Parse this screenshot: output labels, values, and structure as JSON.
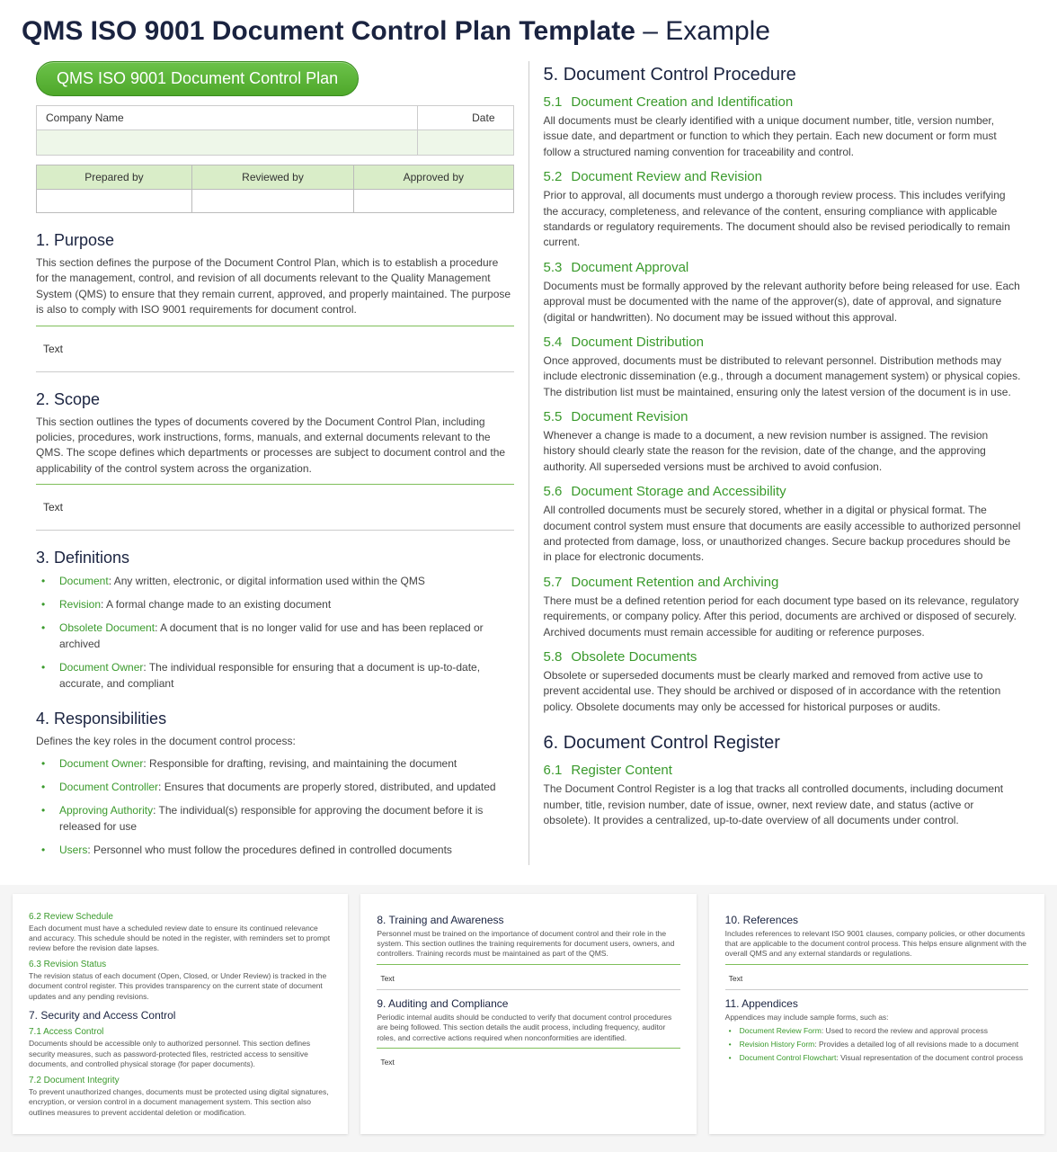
{
  "title_main": "QMS ISO 9001 Document Control Plan Template",
  "title_suffix": " – Example",
  "pill": "QMS ISO 9001 Document Control Plan",
  "meta": {
    "company": "Company Name",
    "date": "Date",
    "blank": ""
  },
  "rev": {
    "prepared": "Prepared by",
    "reviewed": "Reviewed by",
    "approved": "Approved by"
  },
  "sec1": {
    "h": "1. Purpose",
    "p": "This section defines the purpose of the Document Control Plan, which is to establish a procedure for the management, control, and revision of all documents relevant to the Quality Management System (QMS) to ensure that they remain current, approved, and properly maintained. The purpose is also to comply with ISO 9001 requirements for document control.",
    "ph": "Text"
  },
  "sec2": {
    "h": "2. Scope",
    "p": "This section outlines the types of documents covered by the Document Control Plan, including policies, procedures, work instructions, forms, manuals, and external documents relevant to the QMS. The scope defines which departments or processes are subject to document control and the applicability of the control system across the organization.",
    "ph": "Text"
  },
  "sec3": {
    "h": "3. Definitions",
    "items": [
      {
        "t": "Document",
        "d": ": Any written, electronic, or digital information used within the QMS"
      },
      {
        "t": "Revision",
        "d": ": A formal change made to an existing document"
      },
      {
        "t": "Obsolete Document",
        "d": ": A document that is no longer valid for use and has been replaced or archived"
      },
      {
        "t": "Document Owner",
        "d": ": The individual responsible for ensuring that a document is up-to-date, accurate, and compliant"
      }
    ]
  },
  "sec4": {
    "h": "4. Responsibilities",
    "p": "Defines the key roles in the document control process:",
    "items": [
      {
        "t": "Document Owner",
        "d": ": Responsible for drafting, revising, and maintaining the document"
      },
      {
        "t": "Document Controller",
        "d": ": Ensures that documents are properly stored, distributed, and updated"
      },
      {
        "t": "Approving Authority",
        "d": ": The individual(s) responsible for approving the document before it is released for use"
      },
      {
        "t": "Users",
        "d": ": Personnel who must follow the procedures defined in controlled documents"
      }
    ]
  },
  "sec5": {
    "h": "5. Document Control Procedure",
    "subs": [
      {
        "n": "5.1",
        "t": "Document Creation and Identification",
        "p": "All documents must be clearly identified with a unique document number, title, version number, issue date, and department or function to which they pertain. Each new document or form must follow a structured naming convention for traceability and control."
      },
      {
        "n": "5.2",
        "t": "Document Review and Revision",
        "p": "Prior to approval, all documents must undergo a thorough review process. This includes verifying the accuracy, completeness, and relevance of the content, ensuring compliance with applicable standards or regulatory requirements. The document should also be revised periodically to remain current."
      },
      {
        "n": "5.3",
        "t": "Document Approval",
        "p": "Documents must be formally approved by the relevant authority before being released for use. Each approval must be documented with the name of the approver(s), date of approval, and signature (digital or handwritten). No document may be issued without this approval."
      },
      {
        "n": "5.4",
        "t": "Document Distribution",
        "p": "Once approved, documents must be distributed to relevant personnel. Distribution methods may include electronic dissemination (e.g., through a document management system) or physical copies. The distribution list must be maintained, ensuring only the latest version of the document is in use."
      },
      {
        "n": "5.5",
        "t": "Document Revision",
        "p": "Whenever a change is made to a document, a new revision number is assigned. The revision history should clearly state the reason for the revision, date of the change, and the approving authority. All superseded versions must be archived to avoid confusion."
      },
      {
        "n": "5.6",
        "t": "Document Storage and Accessibility",
        "p": "All controlled documents must be securely stored, whether in a digital or physical format. The document control system must ensure that documents are easily accessible to authorized personnel and protected from damage, loss, or unauthorized changes. Secure backup procedures should be in place for electronic documents."
      },
      {
        "n": "5.7",
        "t": "Document Retention and Archiving",
        "p": "There must be a defined retention period for each document type based on its relevance, regulatory requirements, or company policy. After this period, documents are archived or disposed of securely. Archived documents must remain accessible for auditing or reference purposes."
      },
      {
        "n": "5.8",
        "t": "Obsolete Documents",
        "p": "Obsolete or superseded documents must be clearly marked and removed from active use to prevent accidental use. They should be archived or disposed of in accordance with the retention policy. Obsolete documents may only be accessed for historical purposes or audits."
      }
    ]
  },
  "sec6": {
    "h": "6. Document Control Register",
    "sub": {
      "n": "6.1",
      "t": "Register Content",
      "p": "The Document Control Register is a log that tracks all controlled documents, including document number, title, revision number, date of issue, owner, next review date, and status (active or obsolete). It provides a centralized, up-to-date overview of all documents under control."
    }
  },
  "thumb1": {
    "s62": {
      "h": "6.2  Review Schedule",
      "p": "Each document must have a scheduled review date to ensure its continued relevance and accuracy. This schedule should be noted in the register, with reminders set to prompt review before the revision date lapses."
    },
    "s63": {
      "h": "6.3  Revision Status",
      "p": "The revision status of each document (Open, Closed, or Under Review) is tracked in the document control register. This provides transparency on the current state of document updates and any pending revisions."
    },
    "s7": {
      "h": "7. Security and Access Control"
    },
    "s71": {
      "h": "7.1  Access Control",
      "p": "Documents should be accessible only to authorized personnel. This section defines security measures, such as password-protected files, restricted access to sensitive documents, and controlled physical storage (for paper documents)."
    },
    "s72": {
      "h": "7.2  Document Integrity",
      "p": "To prevent unauthorized changes, documents must be protected using digital signatures, encryption, or version control in a document management system. This section also outlines measures to prevent accidental deletion or modification."
    }
  },
  "thumb2": {
    "s8": {
      "h": "8. Training and Awareness",
      "p": "Personnel must be trained on the importance of document control and their role in the system. This section outlines the training requirements for document users, owners, and controllers. Training records must be maintained as part of the QMS.",
      "ph": "Text"
    },
    "s9": {
      "h": "9. Auditing and Compliance",
      "p": "Periodic internal audits should be conducted to verify that document control procedures are being followed. This section details the audit process, including frequency, auditor roles, and corrective actions required when nonconformities are identified.",
      "ph": "Text"
    }
  },
  "thumb3": {
    "s10": {
      "h": "10. References",
      "p": "Includes references to relevant ISO 9001 clauses, company policies, or other documents that are applicable to the document control process. This helps ensure alignment with the overall QMS and any external standards or regulations.",
      "ph": "Text"
    },
    "s11": {
      "h": "11. Appendices",
      "p": "Appendices may include sample forms, such as:",
      "items": [
        {
          "t": "Document Review Form",
          "d": ": Used to record the review and approval process"
        },
        {
          "t": "Revision History Form",
          "d": ": Provides a detailed log of all revisions made to a document"
        },
        {
          "t": "Document Control Flowchart",
          "d": ": Visual representation of the document control process"
        }
      ]
    }
  }
}
